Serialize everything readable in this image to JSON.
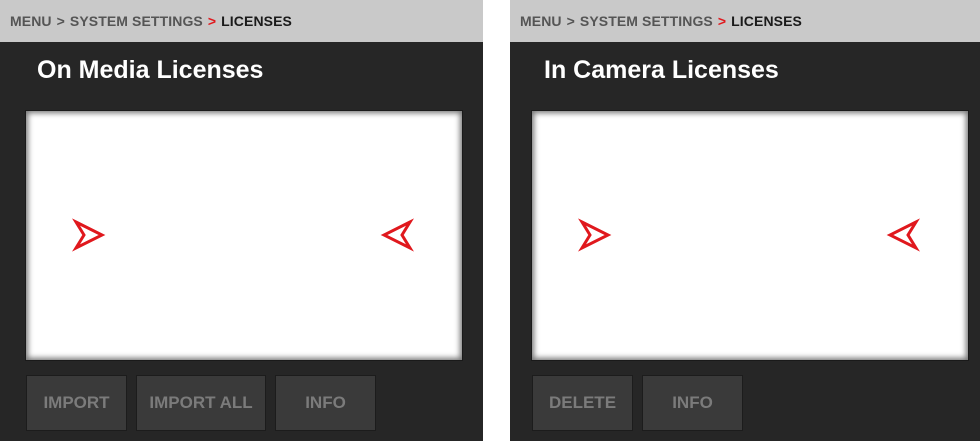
{
  "left_panel": {
    "breadcrumb": {
      "menu": "MENU",
      "system_settings": "SYSTEM SETTINGS",
      "current": "LICENSES",
      "sep": ">"
    },
    "title": "On Media Licenses",
    "buttons": {
      "import": "IMPORT",
      "import_all": "IMPORT ALL",
      "info": "INFO"
    }
  },
  "right_panel": {
    "breadcrumb": {
      "menu": "MENU",
      "system_settings": "SYSTEM SETTINGS",
      "current": "LICENSES",
      "sep": ">"
    },
    "title": "In Camera Licenses",
    "buttons": {
      "delete": "DELETE",
      "info": "INFO"
    }
  },
  "icons": {
    "scroll_right": "chevron-right-icon",
    "scroll_left": "chevron-left-icon"
  },
  "colors": {
    "accent": "#e0181d",
    "panel_bg": "#262626",
    "breadcrumb_bg": "#c9c9c9",
    "button_bg": "#3a3a3a",
    "button_text": "#7b7b7b"
  }
}
